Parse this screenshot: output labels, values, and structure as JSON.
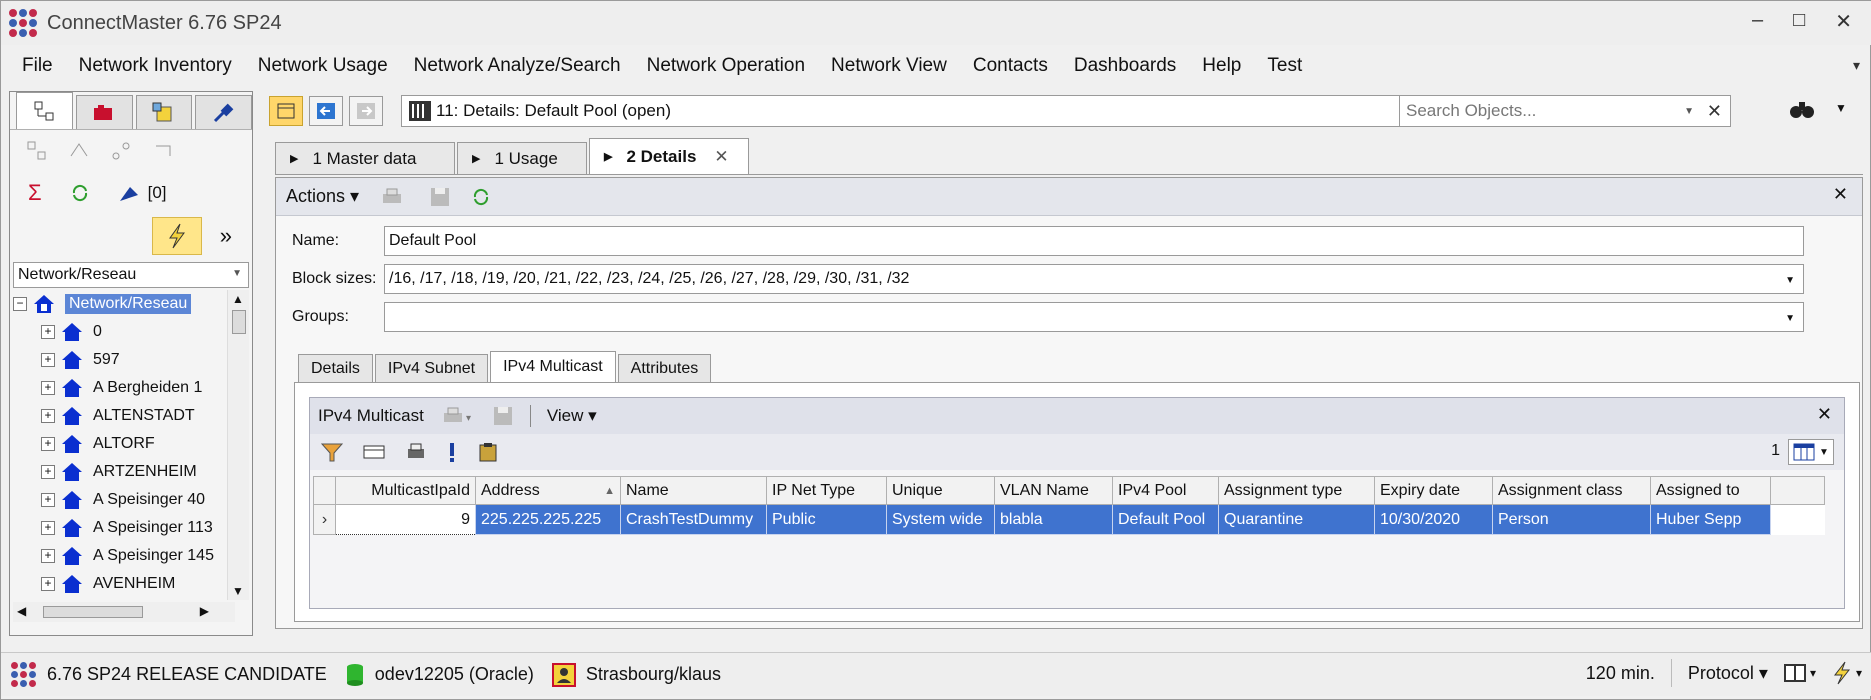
{
  "window": {
    "title": "ConnectMaster 6.76 SP24",
    "minimize": "–",
    "maximize": "□",
    "close": "✕"
  },
  "menu": {
    "items": [
      "File",
      "Network Inventory",
      "Network Usage",
      "Network Analyze/Search",
      "Network Operation",
      "Network View",
      "Contacts",
      "Dashboards",
      "Help",
      "Test"
    ]
  },
  "left_panel": {
    "sum_symbol": "Σ",
    "count_label": "[0]",
    "more_symbol": "»",
    "combo_value": "Network/Reseau",
    "tree": {
      "root": "Network/Reseau",
      "items": [
        "0",
        "597",
        "A Bergheiden 1",
        "ALTENSTADT",
        "ALTORF",
        "ARTZENHEIM",
        "A Speisinger 40",
        "A Speisinger 113",
        "A Speisinger 145",
        "AVENHEIM"
      ]
    }
  },
  "navigation": {
    "path": "11: Details: Default Pool  (open)",
    "search_placeholder": "Search Objects..."
  },
  "tabs": [
    {
      "label": "1 Master data",
      "active": false
    },
    {
      "label": "1 Usage",
      "active": false
    },
    {
      "label": "2 Details",
      "active": true
    }
  ],
  "actions": {
    "label": "Actions"
  },
  "form": {
    "name_label": "Name:",
    "name_value": "Default Pool",
    "block_sizes_label": "Block sizes:",
    "block_sizes_value": "/16, /17, /18, /19, /20, /21, /22, /23, /24, /25, /26, /27, /28, /29, /30, /31, /32",
    "groups_label": "Groups:",
    "groups_value": ""
  },
  "sub_tabs": [
    {
      "label": "Details",
      "active": false
    },
    {
      "label": "IPv4 Subnet",
      "active": false
    },
    {
      "label": "IPv4 Multicast",
      "active": true
    },
    {
      "label": "Attributes",
      "active": false
    }
  ],
  "multicast_panel": {
    "title": "IPv4 Multicast",
    "view_label": "View",
    "count": "1",
    "columns": [
      "MulticastIpaId",
      "Address",
      "Name",
      "IP Net Type",
      "Unique",
      "VLAN Name",
      "IPv4 Pool",
      "Assignment type",
      "Expiry date",
      "Assignment class",
      "Assigned to"
    ],
    "rows": [
      [
        "9",
        "225.225.225.225",
        "CrashTestDummy",
        "Public",
        "System wide",
        "blabla",
        "Default Pool",
        "Quarantine",
        "10/30/2020",
        "Person",
        "Huber Sepp"
      ]
    ]
  },
  "status_bar": {
    "version": "6.76 SP24 RELEASE CANDIDATE",
    "database": "odev12205 (Oracle)",
    "user": "Strasbourg/klaus",
    "timeout": "120 min.",
    "protocol": "Protocol"
  },
  "colors": {
    "selection": "#3f73cf",
    "tree_selected": "#5c86d6",
    "highlight_button": "#ffe68a"
  }
}
